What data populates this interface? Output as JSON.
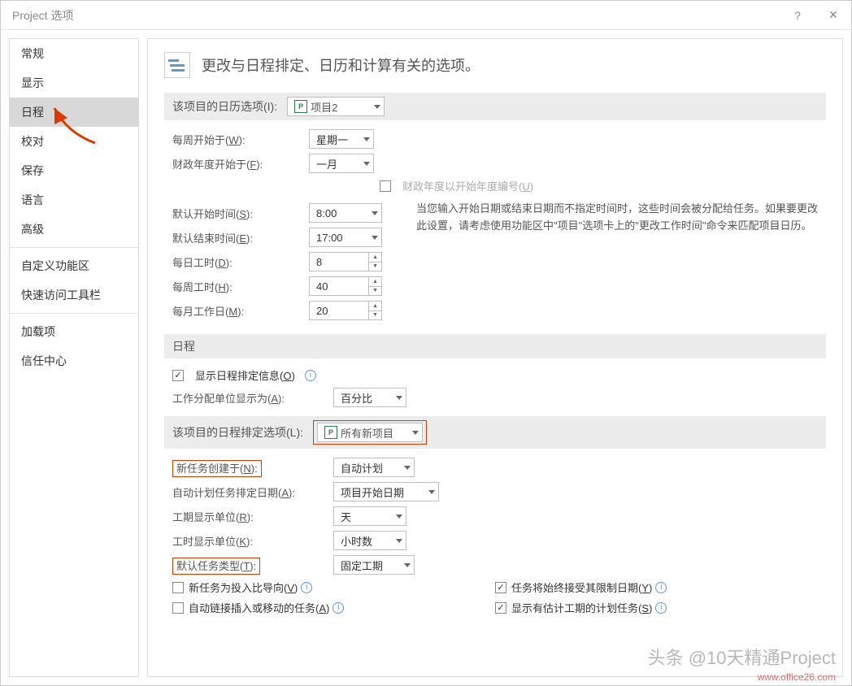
{
  "window": {
    "title": "Project 选项",
    "help": "?",
    "close": "✕"
  },
  "sidebar": {
    "items": [
      {
        "label": "常规"
      },
      {
        "label": "显示"
      },
      {
        "label": "日程",
        "selected": true
      },
      {
        "label": "校对"
      },
      {
        "label": "保存"
      },
      {
        "label": "语言"
      },
      {
        "label": "高级"
      }
    ],
    "items2": [
      {
        "label": "自定义功能区"
      },
      {
        "label": "快速访问工具栏"
      }
    ],
    "items3": [
      {
        "label": "加载项"
      },
      {
        "label": "信任中心"
      }
    ]
  },
  "header": {
    "title": "更改与日程排定、日历和计算有关的选项。"
  },
  "calendar_group": {
    "title": "该项目的日历选项(I):",
    "project": "项目2",
    "week_start_label": "每周开始于(W):",
    "week_start_value": "星期一",
    "fiscal_start_label": "财政年度开始于(F):",
    "fiscal_start_value": "一月",
    "fiscal_numbering_label": "财政年度以开始年度编号(U)",
    "default_start_label": "默认开始时间(S):",
    "default_start_value": "8:00",
    "default_end_label": "默认结束时间(E):",
    "default_end_value": "17:00",
    "hours_day_label": "每日工时(D):",
    "hours_day_value": "8",
    "hours_week_label": "每周工时(H):",
    "hours_week_value": "40",
    "days_month_label": "每月工作日(M):",
    "days_month_value": "20",
    "note": "当您输入开始日期或结束日期而不指定时间时，这些时间会被分配给任务。如果要更改此设置，请考虑使用功能区中\"项目\"选项卡上的\"更改工作时间\"命令来匹配项目日历。"
  },
  "schedule_group": {
    "title": "日程",
    "show_msgs_label": "显示日程排定信息(O)",
    "assignment_units_label": "工作分配单位显示为(A):",
    "assignment_units_value": "百分比"
  },
  "schedule_opts_group": {
    "title": "该项目的日程排定选项(L):",
    "project": "所有新项目",
    "new_tasks_label": "新任务创建于(N):",
    "new_tasks_value": "自动计划",
    "auto_sched_label": "自动计划任务排定日期(A):",
    "auto_sched_value": "项目开始日期",
    "duration_unit_label": "工期显示单位(R):",
    "duration_unit_value": "天",
    "work_unit_label": "工时显示单位(K):",
    "work_unit_value": "小时数",
    "task_type_label": "默认任务类型(T):",
    "task_type_value": "固定工期",
    "effort_driven_label": "新任务为投入比导向(V)",
    "honor_constraints_label": "任务将始终接受其限制日期(Y)",
    "autolink_label": "自动链接插入或移动的任务(A)",
    "show_estimated_label": "显示有估计工期的计划任务(S)"
  },
  "watermark": {
    "main": "头条 @10天精通Project",
    "sub": "www.office26.com"
  }
}
